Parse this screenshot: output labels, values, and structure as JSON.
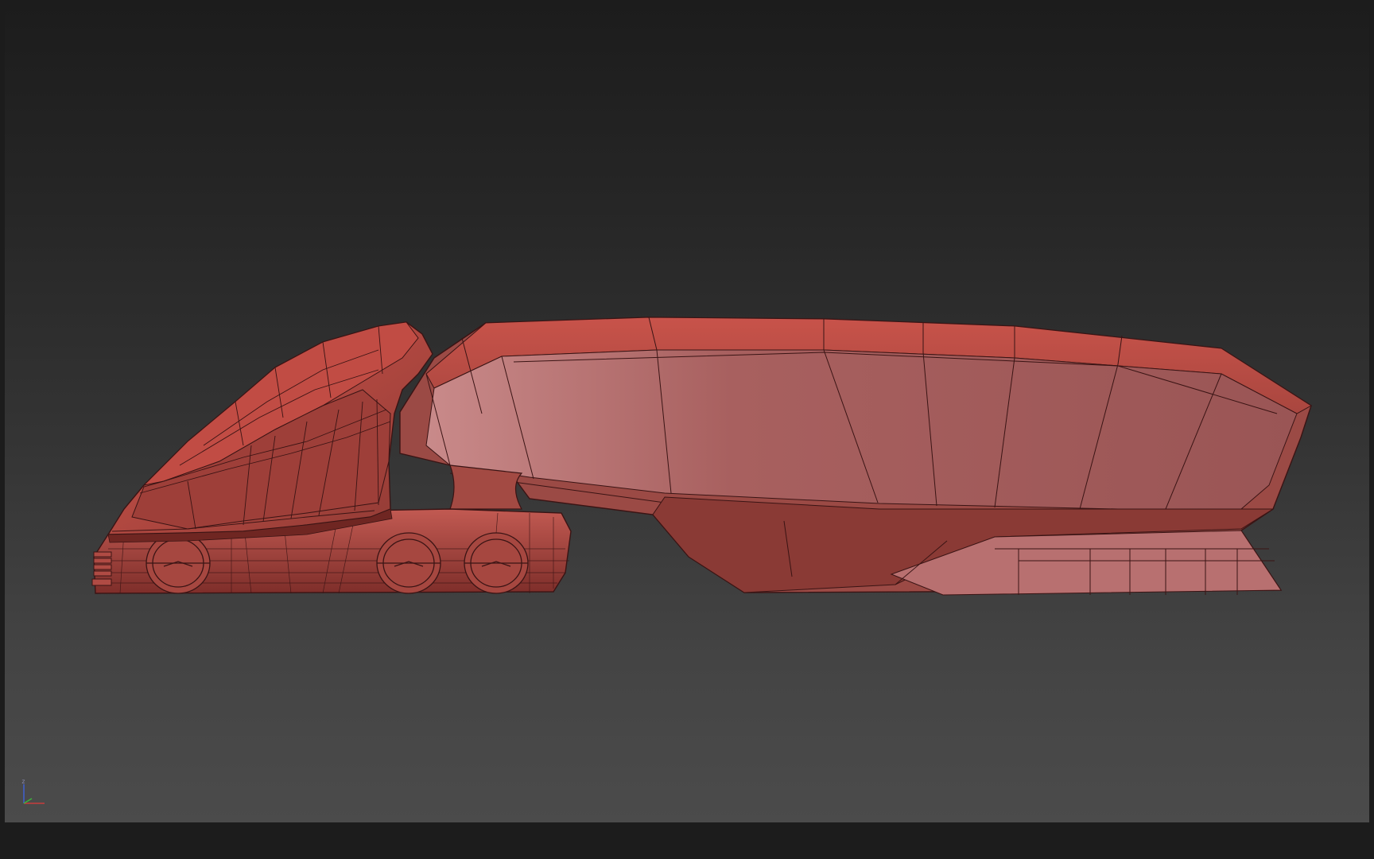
{
  "viewport": {
    "background_top": "#1c1c1c",
    "background_bottom": "#4b4b4b",
    "model_fill": "#b8564d",
    "model_highlight": "#d98a86",
    "wire_color": "#3a1414"
  },
  "axis_gizmo": {
    "z_label": "z",
    "x_color": "#c83c3c",
    "y_color": "#3cb43c",
    "z_color": "#4060d0"
  }
}
